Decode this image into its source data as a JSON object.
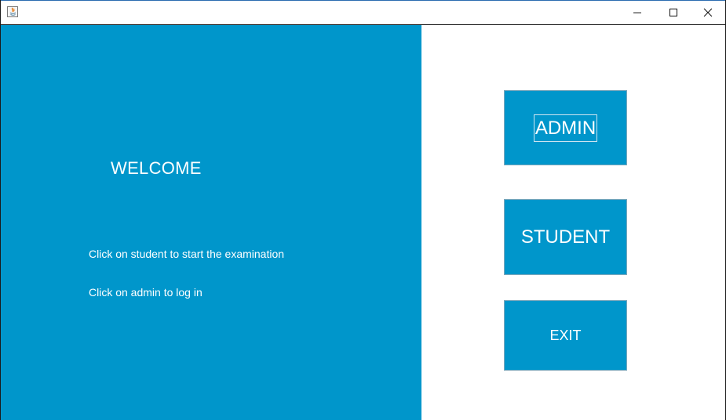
{
  "window": {
    "app_icon": "java-icon",
    "controls": {
      "minimize_icon": "minimize-icon",
      "maximize_icon": "maximize-icon",
      "close_icon": "close-icon"
    }
  },
  "left_panel": {
    "welcome": "WELCOME",
    "instructions": [
      "Click on student to start the examination",
      "Click on admin to log in"
    ],
    "background": "#0096cb"
  },
  "buttons": {
    "admin": "ADMIN",
    "student": "STUDENT",
    "exit": "EXIT"
  }
}
